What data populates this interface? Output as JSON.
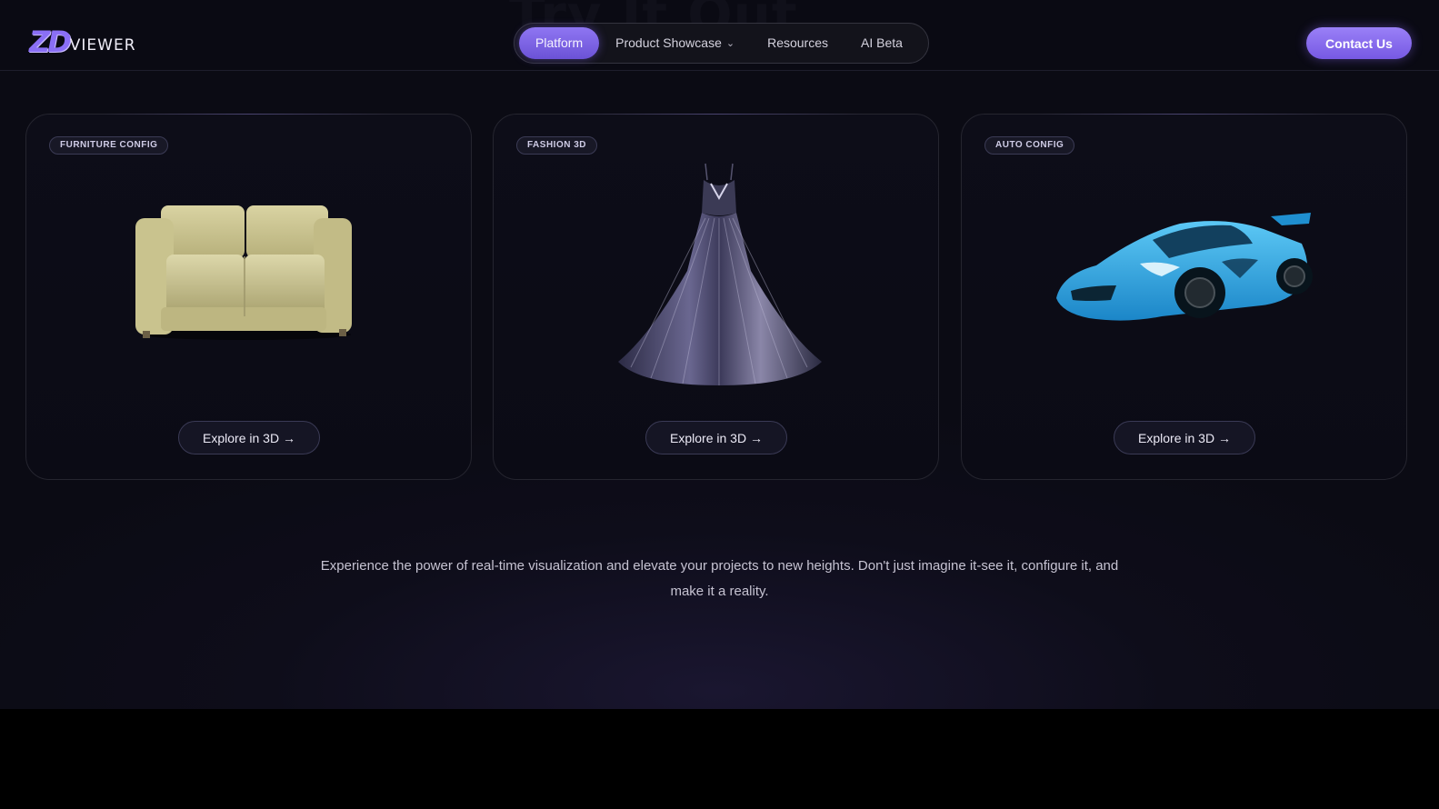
{
  "header": {
    "logo_mark": "ZD",
    "logo_word": "VIEWER",
    "ghost_heading": "Try It Out",
    "nav": [
      {
        "label": "Platform",
        "active": true
      },
      {
        "label": "Product Showcase",
        "has_dropdown": true
      },
      {
        "label": "Resources"
      },
      {
        "label": "AI Beta"
      }
    ],
    "contact_label": "Contact Us"
  },
  "cards": [
    {
      "badge": "FURNITURE CONFIG",
      "image": "sofa",
      "button_label": "Explore in 3D →"
    },
    {
      "badge": "FASHION 3D",
      "image": "gown",
      "button_label": "Explore in 3D →"
    },
    {
      "badge": "AUTO CONFIG",
      "image": "sports-car",
      "button_label": "Explore in 3D →"
    }
  ],
  "tagline": "Experience the power of real-time visualization and elevate your projects to new heights. Don't just imagine it-see it, configure it, and make it a reality.",
  "colors": {
    "accent": "#7b5fe8",
    "background": "#0b0b14",
    "card_border": "#25252f",
    "car_body": "#2aa6e8",
    "sofa": "#cfc894"
  },
  "icons": {
    "dropdown": "chevron-down-icon",
    "arrow": "arrow-right-icon"
  }
}
